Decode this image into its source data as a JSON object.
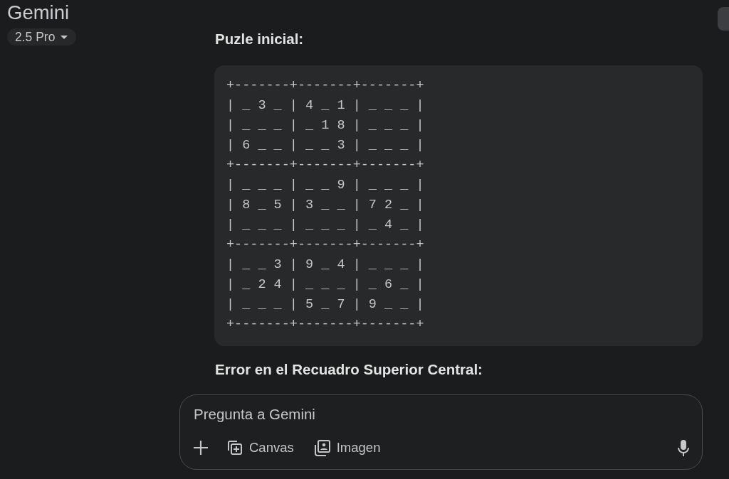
{
  "header": {
    "title": "Gemini",
    "model": "2.5 Pro"
  },
  "message": {
    "heading": "Puzle inicial:",
    "code_lines": [
      "+-------+-------+-------+",
      "| _ 3 _ | 4 _ 1 | _ _ _ |",
      "| _ _ _ | _ 1 8 | _ _ _ |",
      "| 6 _ _ | _ _ 3 | _ _ _ |",
      "+-------+-------+-------+",
      "| _ _ _ | _ _ 9 | _ _ _ |",
      "| 8 _ 5 | 3 _ _ | 7 2 _ |",
      "| _ _ _ | _ _ _ | _ 4 _ |",
      "+-------+-------+-------+",
      "| _ _ 3 | 9 _ 4 | _ _ _ |",
      "| _ 2 4 | _ _ _ | _ 6 _ |",
      "| _ _ _ | 5 _ 7 | 9 _ _ |",
      "+-------+-------+-------+"
    ],
    "subheading": "Error en el Recuadro Superior Central:"
  },
  "composer": {
    "placeholder": "Pregunta a Gemini",
    "tools": [
      {
        "kind": "add"
      },
      {
        "kind": "canvas",
        "label": "Canvas"
      },
      {
        "kind": "image",
        "label": "Imagen"
      }
    ]
  }
}
